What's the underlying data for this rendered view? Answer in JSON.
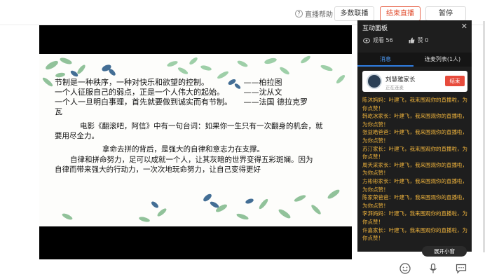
{
  "toolbar": {
    "help_label": "直播帮助",
    "multi_label": "多数联播",
    "end_label": "结束直播",
    "pause_label": "暂停"
  },
  "slide": {
    "lines": [
      "节制是一种秩序，一种对快乐和欲望的控制。　　　　　——柏拉图",
      "一个人征服自己的弱点，正是一个人伟大的起始。　　　——沈从文",
      "一个人一旦明白事理，首先就要做到诚实而有节制。　　——法国 德拉克罗",
      "瓦"
    ],
    "para1_a": "电影《翻滚吧，阿信》中有一句台词：如果你一生只有一次翻身的机会，就",
    "para1_b": "要用尽全力。",
    "para2": "拿命去拼的背后，是强大的自律和意志力在支撑。",
    "para3_a": "自律和拼命努力，足可以成就一个人，让其灰暗的世界变得五彩斑斓。因为",
    "para3_b": "自律而带来强大的行动力，一次次地玩命努力，让自己变得更好"
  },
  "panel": {
    "title": "互动面板",
    "views_label": "观看 56",
    "likes_label": "赞 0",
    "tab_messages": "消息",
    "tab_mic_list": "连麦列表(1人)",
    "mic_user_name": "刘慧雅家长",
    "mic_user_status": "正在连麦",
    "mic_end_label": "结束",
    "messages": [
      "陈沐妈妈：叶建飞，我来围观你的直播啦，为你点赞！",
      "韩屹冰家长：叶建飞，我来围观你的直播啦，为你点赞！",
      "张益皓爸爸：叶建飞，我来围观你的直播啦，为你点赞！",
      "苏汀家长：叶建飞，我来围观你的直播啦，为你点赞！",
      "周天采家长：叶建飞，我来围观你的直播啦，为你点赞！",
      "方彬彬家长：叶建飞，我来围观你的直播啦，为你点赞！",
      "陈家荣爸爸：叶建飞，我来围观你的直播啦，为你点赞！",
      "李湃妈妈：叶建飞，我来围观你的直播啦，为你点赞！",
      "许嘉家长：叶建飞，我来围观你的直播啦，为你点赞！"
    ]
  },
  "float": {
    "expand_label": "展开小窗"
  },
  "icons": {
    "help": "help-circle-icon",
    "eye": "eye-icon",
    "like": "thumbs-up-icon",
    "close": "close-icon",
    "emoji": "emoji-icon",
    "mic": "microphone-icon",
    "chat": "chat-icon"
  },
  "colors": {
    "end_accent": "#e14c2e",
    "tab_active": "#4fa0ff",
    "message_text": "#f0b43c",
    "panel_bg": "#1e1e1e"
  }
}
